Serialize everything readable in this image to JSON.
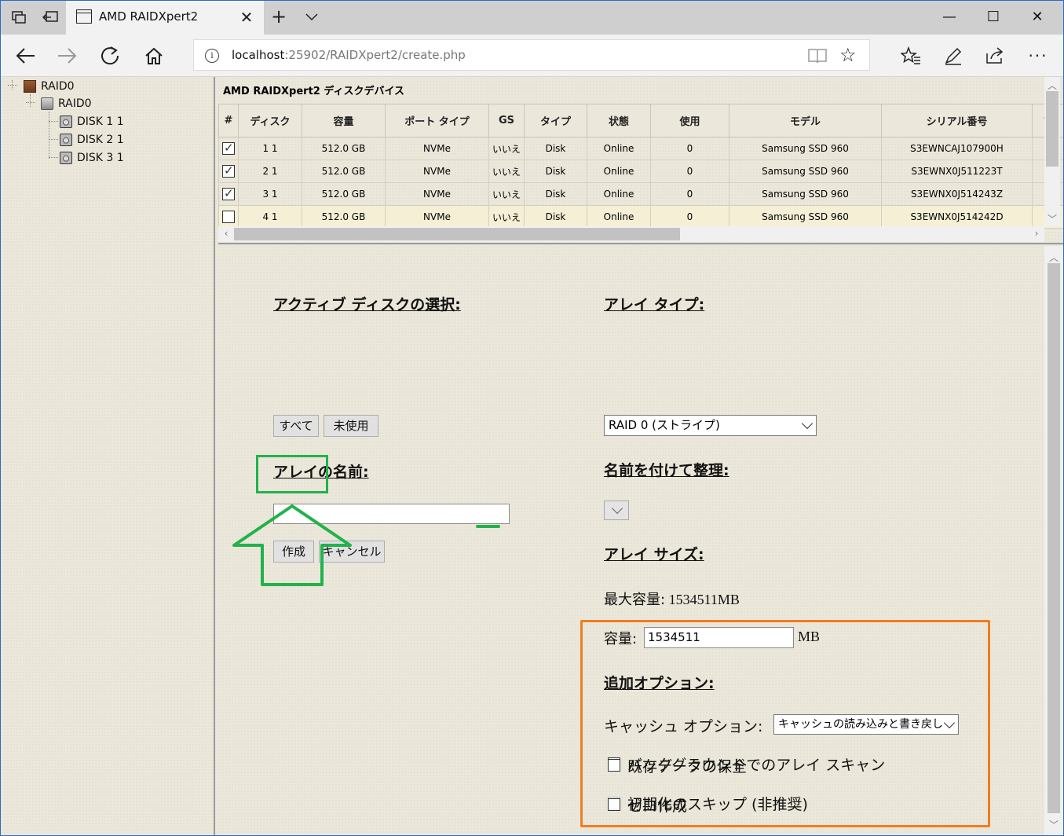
{
  "browser": {
    "tab_title": "AMD RAIDXpert2",
    "url_host": "localhost",
    "url_rest": ":25902/RAIDXpert2/create.php"
  },
  "tree": {
    "root": "RAID0",
    "array": "RAID0",
    "disks": [
      "DISK 1 1",
      "DISK 2 1",
      "DISK 3 1"
    ]
  },
  "device_table": {
    "title": "AMD RAIDXpert2 ディスクデバイス",
    "columns": [
      "#",
      "ディスク",
      "容量",
      "ポート タイプ",
      "GS",
      "タイプ",
      "状態",
      "使用",
      "モデル",
      "シリアル番号",
      "フ"
    ],
    "rows": [
      {
        "checked": true,
        "disk": "1 1",
        "capacity": "512.0 GB",
        "port": "NVMe",
        "gs": "いいえ",
        "type": "Disk",
        "state": "Online",
        "used": "0",
        "model": "Samsung SSD 960",
        "serial": "S3EWNCAJ107900H"
      },
      {
        "checked": true,
        "disk": "2 1",
        "capacity": "512.0 GB",
        "port": "NVMe",
        "gs": "いいえ",
        "type": "Disk",
        "state": "Online",
        "used": "0",
        "model": "Samsung SSD 960",
        "serial": "S3EWNX0J511223T"
      },
      {
        "checked": true,
        "disk": "3 1",
        "capacity": "512.0 GB",
        "port": "NVMe",
        "gs": "いいえ",
        "type": "Disk",
        "state": "Online",
        "used": "0",
        "model": "Samsung SSD 960",
        "serial": "S3EWNX0J514243Z"
      },
      {
        "checked": false,
        "disk": "4 1",
        "capacity": "512.0 GB",
        "port": "NVMe",
        "gs": "いいえ",
        "type": "Disk",
        "state": "Online",
        "used": "0",
        "model": "Samsung SSD 960",
        "serial": "S3EWNX0J514242D"
      }
    ]
  },
  "form": {
    "active_disk_label": "アクティブ ディスクの選択:",
    "btn_all": "すべて",
    "btn_unused": "未使用",
    "array_name_label": "アレイの名前:",
    "array_name_value": "",
    "btn_create": "作成",
    "btn_cancel": "キャンセル",
    "array_type_label": "アレイ タイプ:",
    "array_type_value": "RAID 0 (ストライプ)",
    "organize_label": "名前を付けて整理:",
    "organize_value": "",
    "array_size_label": "アレイ サイズ:",
    "max_capacity_label": "最大容量:",
    "max_capacity_value": "1534511MB",
    "capacity_label": "容量:",
    "capacity_value": "1534511",
    "capacity_unit": "MB",
    "extra_options_label": "追加オプション:",
    "cache_option_label": "キャッシュ オプション:",
    "cache_option_value": "キャッシュの読み込みと書き戻し",
    "opt_background_scan": "バックグラウンドでのアレイ スキャン",
    "opt_skip_init": "初期化のスキップ (非推奨)",
    "opt_preserve_data": "既存データの保全",
    "opt_zero_create": "ゼロ作成"
  },
  "colors": {
    "annotation_green": "#22b24c",
    "annotation_orange": "#f07d1f"
  }
}
